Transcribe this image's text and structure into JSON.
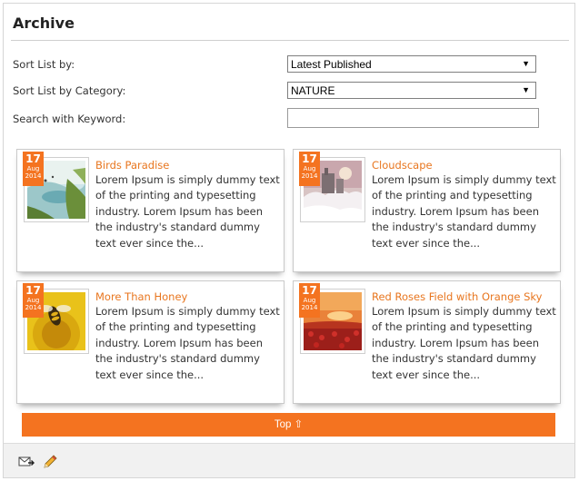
{
  "archive": {
    "title": "Archive"
  },
  "filters": {
    "sort_label": "Sort List by:",
    "sort_value": "Latest Published",
    "category_label": "Sort List by Category:",
    "category_value": "NATURE",
    "keyword_label": "Search with Keyword:",
    "keyword_value": ""
  },
  "articles": [
    {
      "title": "Birds Paradise",
      "day": "17",
      "month": "Aug",
      "year": "2014",
      "excerpt": "Lorem Ipsum is simply dummy text of the printing and typesetting industry. Lorem Ipsum has been the industry's standard dummy text ever since the..."
    },
    {
      "title": "Cloudscape",
      "day": "17",
      "month": "Aug",
      "year": "2014",
      "excerpt": "Lorem Ipsum is simply dummy text of the printing and typesetting industry. Lorem Ipsum has been the industry's standard dummy text ever since the..."
    },
    {
      "title": "More Than Honey",
      "day": "17",
      "month": "Aug",
      "year": "2014",
      "excerpt": "Lorem Ipsum is simply dummy text of the printing and typesetting industry. Lorem Ipsum has been the industry's standard dummy text ever since the..."
    },
    {
      "title": "Red Roses Field with Orange Sky",
      "day": "17",
      "month": "Aug",
      "year": "2014",
      "excerpt": "Lorem Ipsum is simply dummy text of the printing and typesetting industry. Lorem Ipsum has been the industry's standard dummy text ever since the..."
    }
  ],
  "top_button": {
    "label": "Top ⇧"
  },
  "footer": {
    "icons": [
      "email-icon",
      "pencil-icon"
    ]
  },
  "colors": {
    "accent": "#f47320",
    "title_link": "#e8761f",
    "border": "#c9c9c9"
  }
}
